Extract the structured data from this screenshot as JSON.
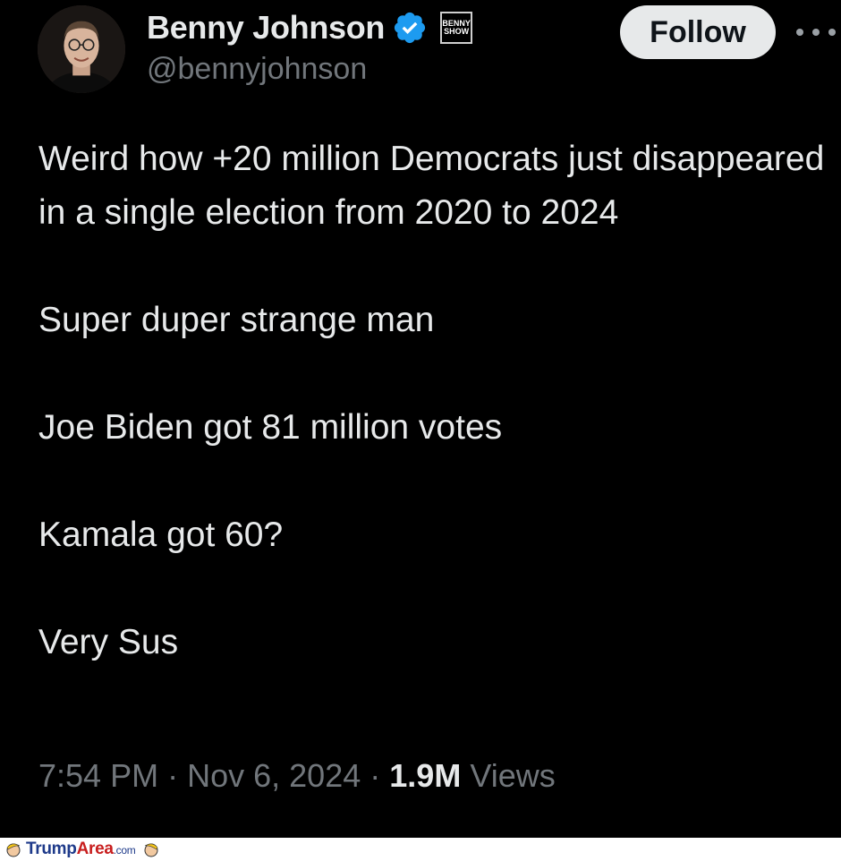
{
  "tweet": {
    "author": {
      "display_name": "Benny Johnson",
      "handle": "@bennyjohnson",
      "verified": true,
      "affiliate_badge_text": [
        "BENNY",
        "SHOW"
      ]
    },
    "follow_label": "Follow",
    "more_icon": "more-horizontal-icon",
    "paragraphs": [
      "Weird how +20 million Democrats just disappeared in a single election from 2020 to 2024",
      "Super duper strange man",
      "Joe Biden got 81 million votes",
      "Kamala got 60?",
      "Very Sus"
    ],
    "meta": {
      "time": "7:54 PM",
      "separator": "·",
      "date": "Nov 6, 2024",
      "views_count": "1.9M",
      "views_label": "Views"
    }
  },
  "watermark": {
    "site_main": "Trump",
    "site_accent": "Area",
    "site_domain": ".com"
  },
  "colors": {
    "background": "#000000",
    "text": "#e7e9ea",
    "muted": "#71767b",
    "verified_blue": "#1d9bf0",
    "follow_bg": "#e7e9ea"
  }
}
